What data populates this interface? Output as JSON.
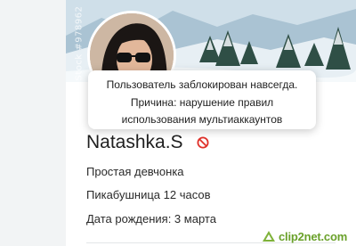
{
  "cover": {
    "watermark_text": "Stock #978962"
  },
  "tooltip": {
    "line1": "Пользователь заблокирован навсегда.",
    "line2": "Причина: нарушение правил",
    "line3": "использования мультиаккаунтов"
  },
  "profile": {
    "username": "Natashka.S",
    "status_icon": "ban-icon",
    "about": "Простая девчонка",
    "rank": "Пикабушница 12 часов",
    "birthday": "Дата рождения: 3 марта"
  },
  "branding": {
    "logo_text": "clip2net.com"
  },
  "colors": {
    "ban_red": "#e0312a",
    "logo_green": "#6aa12a"
  }
}
